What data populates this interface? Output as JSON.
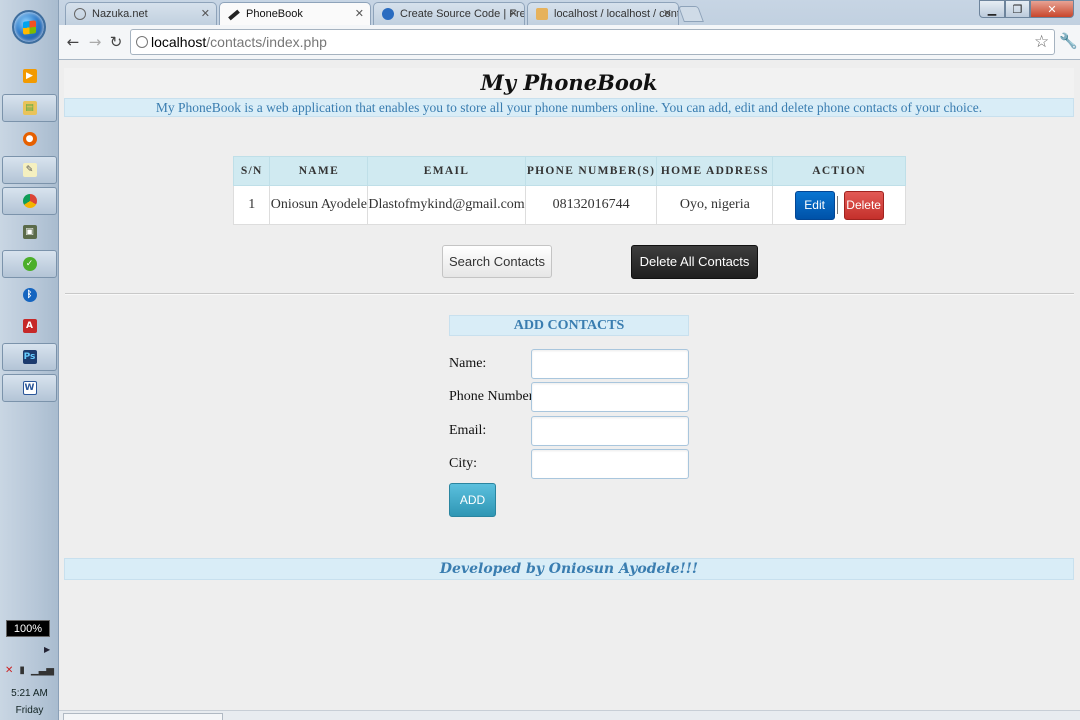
{
  "taskbar": {
    "battery_label": "100%",
    "clock_time": "5:21 AM",
    "clock_day": "Friday",
    "icons": [
      "media-player-icon",
      "file-explorer-icon",
      "firefox-icon",
      "notepad-icon",
      "chrome-icon",
      "device-icon",
      "green-app-icon",
      "bluetooth-icon",
      "acrobat-icon",
      "photoshop-icon",
      "word-icon"
    ]
  },
  "browser": {
    "tabs": [
      {
        "label": "Nazuka.net",
        "active": false
      },
      {
        "label": "PhoneBook",
        "active": true
      },
      {
        "label": "Create Source Code | Free s",
        "active": false
      },
      {
        "label": "localhost / localhost / conte",
        "active": false
      }
    ],
    "url_host": "localhost",
    "url_path": "/contacts/index.php"
  },
  "page": {
    "title": "My PhoneBook",
    "description": "My PhoneBook is a web application that enables you to store all your phone numbers online. You can add, edit and delete phone contacts of your choice.",
    "table": {
      "headers": [
        "S/N",
        "NAME",
        "EMAIL",
        "PHONE NUMBER(S)",
        "HOME ADDRESS",
        "ACTION"
      ],
      "rows": [
        {
          "sn": "1",
          "name": "Oniosun Ayodele",
          "email": "Dlastofmykind@gmail.com",
          "phone": "08132016744",
          "address": "Oyo, nigeria",
          "edit_label": "Edit",
          "delete_label": "Delete"
        }
      ]
    },
    "search_button": "Search Contacts",
    "delete_all_button": "Delete All Contacts",
    "form": {
      "heading": "ADD CONTACTS",
      "fields": [
        {
          "label": "Name:",
          "value": ""
        },
        {
          "label": "Phone Number:",
          "value": ""
        },
        {
          "label": "Email:",
          "value": ""
        },
        {
          "label": "City:",
          "value": ""
        }
      ],
      "submit_label": "ADD"
    },
    "footer": "Developed by Oniosun Ayodele!!!"
  },
  "colors": {
    "accent_text": "#3a7db0",
    "info_background": "#d9edf7",
    "table_header": "#d0eaf1",
    "edit_button": "#0a6ed0",
    "delete_button": "#d9433e",
    "add_button": "#49afcd"
  }
}
